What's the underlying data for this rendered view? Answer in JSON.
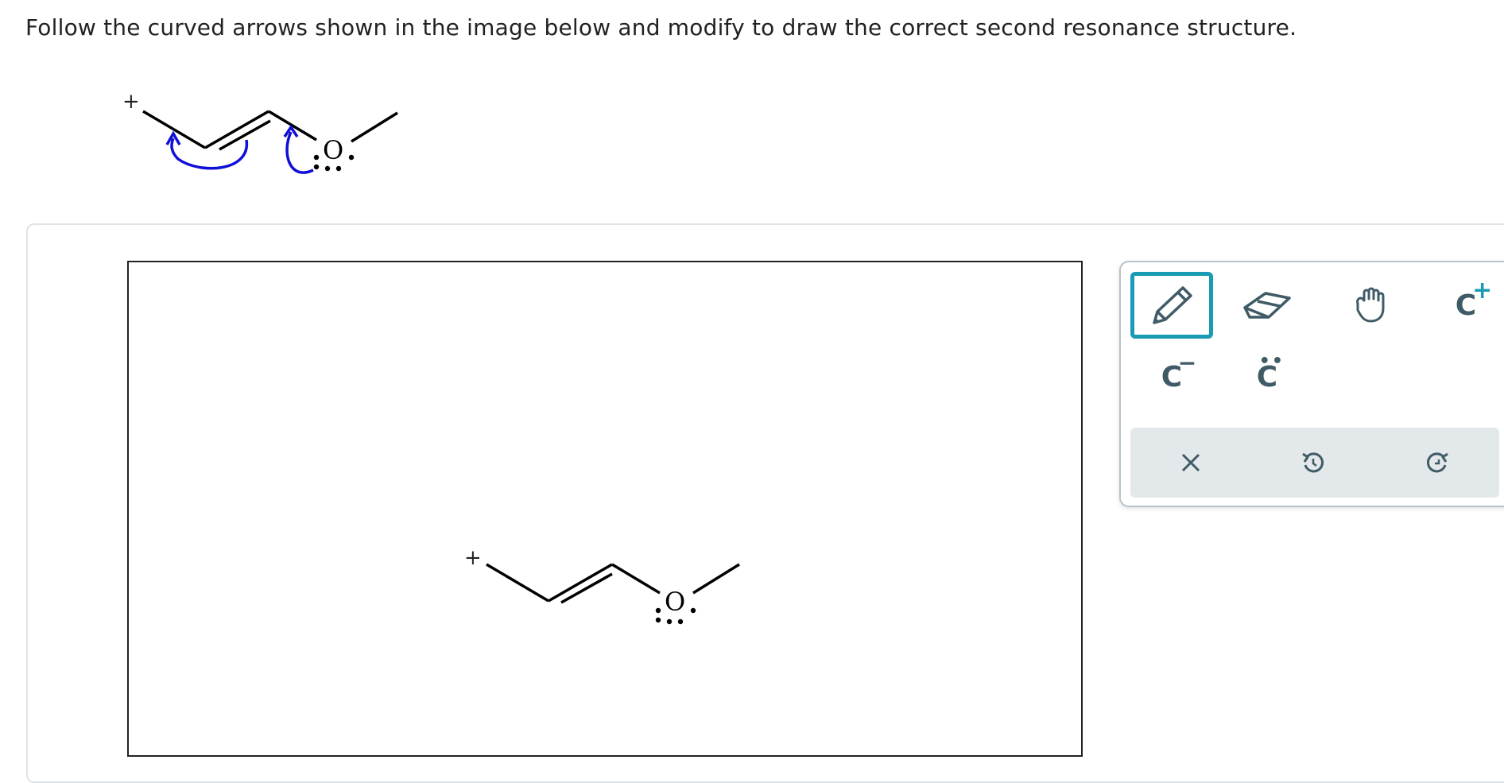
{
  "prompt": "Follow the curved arrows shown in the image below and modify to draw the correct second resonance structure.",
  "question": {
    "charge": "+",
    "atom": "O",
    "lone_pair_color": "#000000",
    "arrow_color": "#1010d8"
  },
  "canvas": {
    "charge": "+",
    "atom": "O"
  },
  "toolbar": {
    "tools": [
      {
        "name": "pencil",
        "icon": "pencil-icon",
        "selected": true
      },
      {
        "name": "eraser",
        "icon": "eraser-icon"
      },
      {
        "name": "hand",
        "icon": "hand-icon"
      },
      {
        "name": "cation",
        "icon": "carbocation-icon",
        "label": "C",
        "charge": "+"
      },
      {
        "name": "anion",
        "icon": "carbanion-icon",
        "label": "C",
        "charge": "−"
      },
      {
        "name": "lone-pair",
        "icon": "lone-pair-icon",
        "label": "C"
      }
    ],
    "actions": [
      {
        "name": "clear",
        "icon": "close-icon"
      },
      {
        "name": "undo",
        "icon": "undo-icon"
      },
      {
        "name": "redo",
        "icon": "redo-icon"
      }
    ],
    "accent": "#1a9bb5",
    "icon_color": "#3f5b66"
  }
}
